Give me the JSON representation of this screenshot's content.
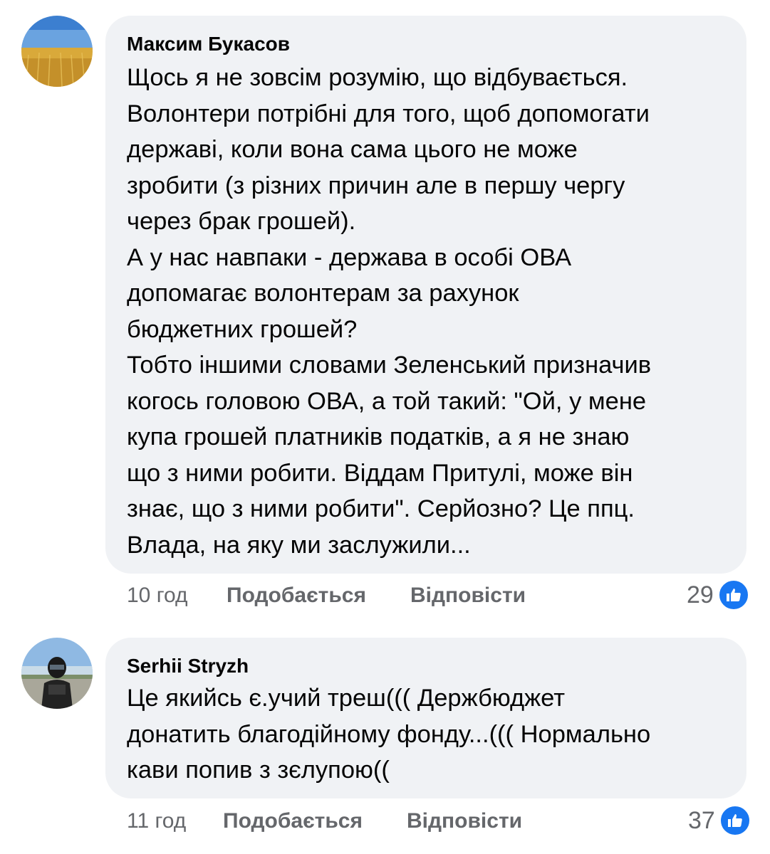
{
  "comments": [
    {
      "author": "Максим Букасов",
      "lines": [
        "Щось я не зовсім розумію, що відбувається.",
        "Волонтери потрібні для того, щоб допомогати",
        "державі, коли вона сама цього не може",
        "зробити (з різних причин але в першу чергу",
        "через брак грошей).",
        "А у нас навпаки - держава в особі ОВА",
        "допомагає волонтерам за рахунок",
        "бюджетних грошей?",
        "Тобто іншими словами Зеленський призначив",
        "когось головою ОВА, а той такий: \"Ой, у мене",
        "купа грошей платників податків, а я не знаю",
        "що з ними робити. Віддам Притулі, може він",
        "знає, що з ними робити\". Серйозно? Це ппц.",
        "Влада, на яку ми заслужили..."
      ],
      "time": "10 год",
      "like_label": "Подобається",
      "reply_label": "Відповісти",
      "reaction_count": "29"
    },
    {
      "author": "Serhii Stryzh",
      "lines": [
        "Це якийсь є.учий треш((( Держбюджет",
        "донатить благодійному фонду...((( Нормально",
        "кави попив з зєлупою(("
      ],
      "time": "11 год",
      "like_label": "Подобається",
      "reply_label": "Відповісти",
      "reaction_count": "37"
    }
  ],
  "colors": {
    "bubble": "#f0f2f5",
    "meta_text": "#65676b",
    "like_blue": "#1877f2",
    "flag_blue": "#2f6fc4",
    "flag_yellow": "#e0b33a"
  }
}
